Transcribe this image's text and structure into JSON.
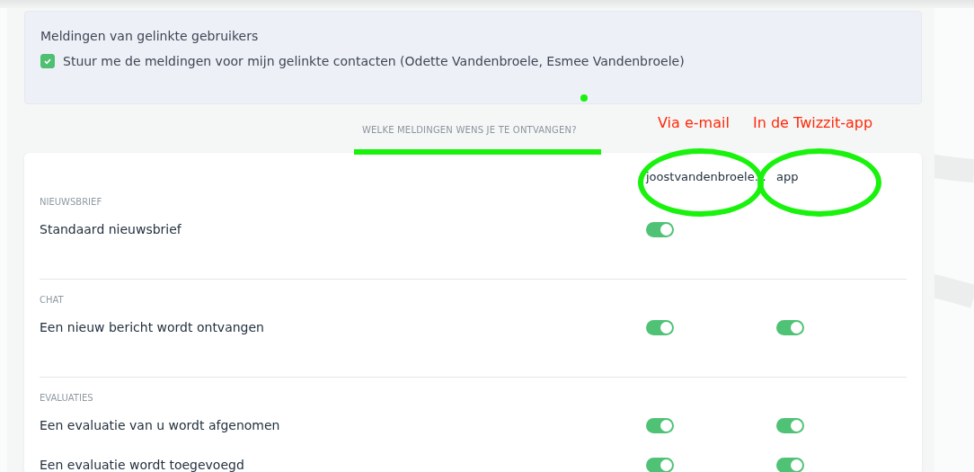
{
  "linked_users": {
    "title": "Meldingen van gelinkte gebruikers",
    "checkbox": {
      "label": "Stuur me de meldingen voor mijn gelinkte contacten (Odette Vandenbroele, Esmee Vandenbroele)",
      "checked": true
    }
  },
  "section_heading": "WELKE MELDINGEN WENS JE TE ONTVANGEN?",
  "annotations": [
    {
      "kind": "text",
      "text": "Via e-mail"
    },
    {
      "kind": "text",
      "text": "In de Twizzit-app"
    },
    {
      "kind": "underline"
    },
    {
      "kind": "dot"
    },
    {
      "kind": "ellipse"
    },
    {
      "kind": "ellipse"
    }
  ],
  "columns": [
    "joostvandenbroele…",
    "app"
  ],
  "sections": [
    {
      "title": "NIEUWSBRIEF",
      "rows": [
        {
          "label": "Standaard nieuwsbrief",
          "cells": [
            {
              "kind": "toggle",
              "on": true
            },
            {
              "kind": "empty"
            }
          ]
        }
      ]
    },
    {
      "title": "CHAT",
      "rows": [
        {
          "label": "Een nieuw bericht wordt ontvangen",
          "cells": [
            {
              "kind": "toggle",
              "on": true
            },
            {
              "kind": "toggle",
              "on": true
            }
          ]
        }
      ]
    },
    {
      "title": "EVALUATIES",
      "rows": [
        {
          "label": "Een evaluatie van u wordt afgenomen",
          "cells": [
            {
              "kind": "toggle",
              "on": true
            },
            {
              "kind": "toggle",
              "on": true
            }
          ]
        },
        {
          "label": "Een evaluatie wordt toegevoegd",
          "cells": [
            {
              "kind": "toggle",
              "on": true
            },
            {
              "kind": "toggle",
              "on": true
            }
          ]
        }
      ]
    }
  ]
}
